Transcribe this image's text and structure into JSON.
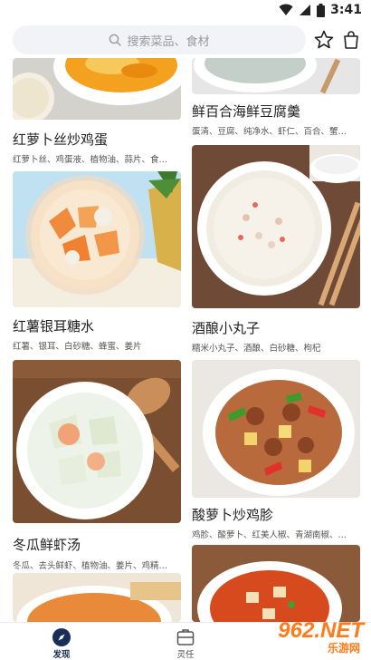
{
  "status": {
    "time": "3:41"
  },
  "search": {
    "placeholder": "搜索菜品、食材"
  },
  "recipes": [
    {
      "title": "红萝卜丝炒鸡蛋",
      "ingredients": "红萝卜丝、鸡蛋液、植物油、蒜片、食…"
    },
    {
      "title": "鲜百合海鲜豆腐羹",
      "ingredients": "蛋清、豆腐、纯净水、虾仁、百合、蟹…"
    },
    {
      "title": "红薯银耳糖水",
      "ingredients": "红薯、银耳、白砂糖、蜂蜜、姜片"
    },
    {
      "title": "酒酿小丸子",
      "ingredients": "糯米小丸子、酒酿、白砂糖、枸杞"
    },
    {
      "title": "冬瓜鲜虾汤",
      "ingredients": "冬瓜、去头鲜虾、植物油、姜片、鸡精…"
    },
    {
      "title": "酸萝卜炒鸡胗",
      "ingredients": "鸡胗、酸萝卜、红美人椒、青湖南椒、…"
    }
  ],
  "tabs": [
    {
      "label": "发现",
      "active": true,
      "icon": "compass-icon"
    },
    {
      "label": "灵任",
      "active": false,
      "icon": "briefcase-icon"
    }
  ],
  "watermark": {
    "brand": "962.NET",
    "sub": "乐游网"
  },
  "colors": {
    "accent": "#1a2f57",
    "watermark": "#ff7a18"
  }
}
